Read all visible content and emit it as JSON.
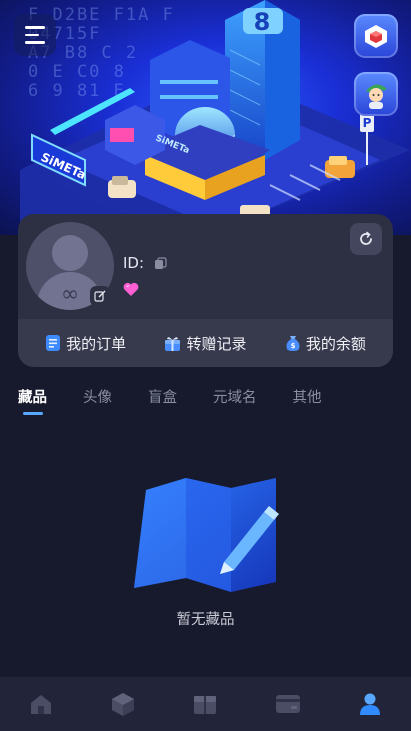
{
  "hero": {
    "banner_text": "F D2BE F1A F\n04715F\nA7 B8 C 2\n0 E C0 8\n6 9 81 E",
    "sign_left": "SiMETa",
    "sign_front": "SiMETa",
    "parking_letter": "P",
    "tower_number": "8"
  },
  "profile": {
    "id_label": "ID:",
    "id_value": "",
    "avatar_symbol": "∞"
  },
  "actions": [
    {
      "label": "我的订单",
      "icon": "order-icon"
    },
    {
      "label": "转赠记录",
      "icon": "gift-icon"
    },
    {
      "label": "我的余额",
      "icon": "wallet-icon"
    }
  ],
  "tabs": [
    {
      "label": "藏品",
      "active": true
    },
    {
      "label": "头像",
      "active": false
    },
    {
      "label": "盲盒",
      "active": false
    },
    {
      "label": "元域名",
      "active": false
    },
    {
      "label": "其他",
      "active": false
    }
  ],
  "empty_state": {
    "text": "暂无藏品",
    "icon": "map-pencil-icon"
  },
  "bottom_nav": [
    {
      "icon": "home-icon",
      "active": false
    },
    {
      "icon": "box-icon",
      "active": false
    },
    {
      "icon": "mystery-box-icon",
      "active": false
    },
    {
      "icon": "card-icon",
      "active": false
    },
    {
      "icon": "user-icon",
      "active": true
    }
  ],
  "colors": {
    "accent": "#59a8ff",
    "background": "#171a2c",
    "card": "#2d3043",
    "heart": "#ff5fd2"
  }
}
